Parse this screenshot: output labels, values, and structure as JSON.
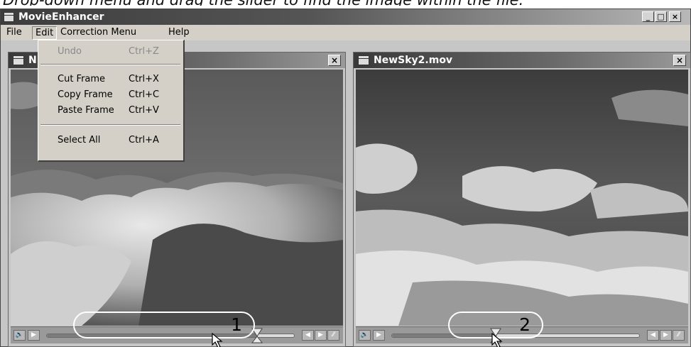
{
  "caption": "Drop-down menu and drag the slider to find the image within the file.",
  "app": {
    "title": "MovieEnhancer"
  },
  "window_controls": {
    "minimize": "_",
    "maximize": "□",
    "close": "×"
  },
  "menubar": {
    "items": [
      "File",
      "Edit",
      "Correction Menu",
      "Help"
    ],
    "open_index": 1
  },
  "edit_menu": {
    "items": [
      {
        "label": "Undo",
        "shortcut": "Ctrl+Z",
        "enabled": false
      },
      {
        "label": "Cut Frame",
        "shortcut": "Ctrl+X",
        "enabled": true
      },
      {
        "label": "Copy Frame",
        "shortcut": "Ctrl+C",
        "enabled": true
      },
      {
        "label": "Paste Frame",
        "shortcut": "Ctrl+V",
        "enabled": true
      },
      {
        "label": "Select All",
        "shortcut": "Ctrl+A",
        "enabled": true
      }
    ]
  },
  "windows": [
    {
      "title": "N",
      "close": "×",
      "slider_position": 0.85,
      "callout": "1"
    },
    {
      "title": "NewSky2.mov",
      "close": "×",
      "slider_position": 0.42,
      "callout": "2"
    }
  ],
  "player_controls": {
    "volume": "🔊",
    "play": "▶",
    "step_back": "◀",
    "step_forward": "▶"
  },
  "colors": {
    "titlebar": "#3d3d3d",
    "menu": "#d4d0c8",
    "sky": "#3a3a3a",
    "cloud": "#d8d8d8"
  }
}
